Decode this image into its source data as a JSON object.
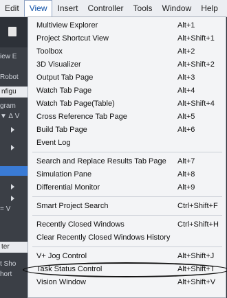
{
  "menubar": {
    "items": [
      "Edit",
      "View",
      "Insert",
      "Controller",
      "Tools",
      "Window",
      "Help"
    ]
  },
  "background": {
    "labels": [
      "iew E",
      "Robot",
      "nfigu",
      "gram",
      "▼ ∆ V",
      "= V",
      "ter",
      "t Sho",
      "hort"
    ]
  },
  "menu": {
    "items": [
      {
        "label": "Multiview Explorer",
        "shortcut": "Alt+1"
      },
      {
        "label": "Project Shortcut View",
        "shortcut": "Alt+Shift+1"
      },
      {
        "label": "Toolbox",
        "shortcut": "Alt+2"
      },
      {
        "label": "3D Visualizer",
        "shortcut": "Alt+Shift+2"
      },
      {
        "label": "Output Tab Page",
        "shortcut": "Alt+3"
      },
      {
        "label": "Watch Tab Page",
        "shortcut": "Alt+4"
      },
      {
        "label": "Watch Tab Page(Table)",
        "shortcut": "Alt+Shift+4"
      },
      {
        "label": "Cross Reference Tab Page",
        "shortcut": "Alt+5"
      },
      {
        "label": "Build Tab Page",
        "shortcut": "Alt+6"
      },
      {
        "label": "Event Log",
        "shortcut": ""
      },
      {
        "label": "Search and Replace Results Tab Page",
        "shortcut": "Alt+7"
      },
      {
        "label": "Simulation Pane",
        "shortcut": "Alt+8"
      },
      {
        "label": "Differential Monitor",
        "shortcut": "Alt+9"
      },
      {
        "label": "Smart Project Search",
        "shortcut": "Ctrl+Shift+F"
      },
      {
        "label": "Recently Closed Windows",
        "shortcut": "Ctrl+Shift+H"
      },
      {
        "label": "Clear Recently Closed Windows History",
        "shortcut": ""
      },
      {
        "label": "V+ Jog Control",
        "shortcut": "Alt+Shift+J"
      },
      {
        "label": "Task Status Control",
        "shortcut": "Alt+Shift+T"
      },
      {
        "label": "Vision Window",
        "shortcut": "Alt+Shift+V"
      }
    ]
  }
}
